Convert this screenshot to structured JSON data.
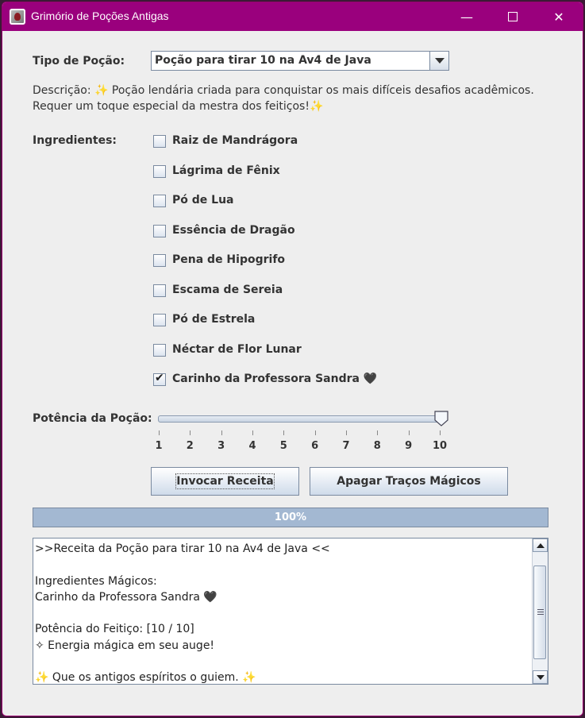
{
  "window": {
    "title": "Grimório de Poções Antigas",
    "controls": {
      "minimize": "—",
      "close": "✕"
    }
  },
  "form": {
    "type_label": "Tipo de Poção:",
    "type_selected": "Poção para tirar 10 na Av4 de Java",
    "description": "Descrição: ✨ Poção lendária criada para conquistar os mais difíceis desafios acadêmicos. Requer um toque especial da mestra dos feitiços!✨",
    "ingredients_label": "Ingredientes:",
    "ingredients": [
      {
        "label": "Raiz de Mandrágora",
        "checked": false
      },
      {
        "label": "Lágrima de Fênix",
        "checked": false
      },
      {
        "label": "Pó de Lua",
        "checked": false
      },
      {
        "label": "Essência de Dragão",
        "checked": false
      },
      {
        "label": "Pena de Hipogrifo",
        "checked": false
      },
      {
        "label": "Escama de Sereia",
        "checked": false
      },
      {
        "label": "Pó de Estrela",
        "checked": false
      },
      {
        "label": "Néctar de Flor Lunar",
        "checked": false
      },
      {
        "label": "Carinho da Professora Sandra 🖤",
        "checked": true
      }
    ],
    "potency_label": "Potência da Poção:",
    "potency_value": 10,
    "potency_ticks": [
      "1",
      "2",
      "3",
      "4",
      "5",
      "6",
      "7",
      "8",
      "9",
      "10"
    ]
  },
  "buttons": {
    "invoke": "Invocar Receita",
    "erase": "Apagar Traços Mágicos"
  },
  "progress": {
    "value": 100,
    "label": "100%"
  },
  "output": {
    "lines": [
      ">>Receita da Poção para tirar 10 na Av4 de Java <<",
      "",
      "Ingredientes Mágicos:",
      "Carinho da Professora Sandra 🖤",
      "",
      "Potência do Feitiço: [10 / 10]",
      "✧ Energia mágica em seu auge!",
      "",
      "✨ Que os antigos espíritos o guiem. ✨"
    ]
  },
  "colors": {
    "titlebar": "#9a007d",
    "progress_fill": "#a3b8d2",
    "window_bg": "#eeeeee"
  }
}
